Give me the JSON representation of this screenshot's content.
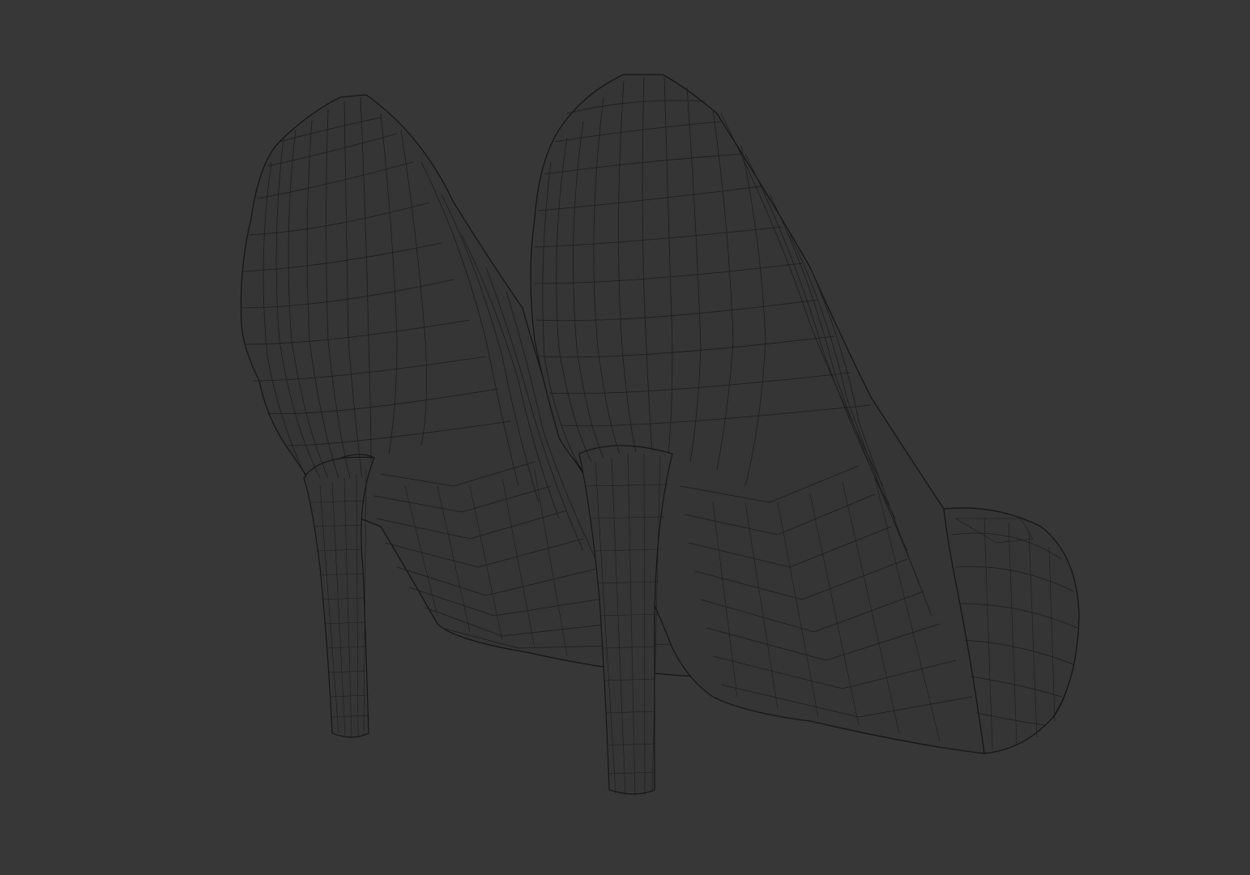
{
  "viewport": {
    "background": "#373737",
    "wire_color": "#161616",
    "mode": "wireframe"
  },
  "scene": {
    "objects": [
      {
        "name": "shoe-left"
      },
      {
        "name": "shoe-right"
      }
    ]
  }
}
